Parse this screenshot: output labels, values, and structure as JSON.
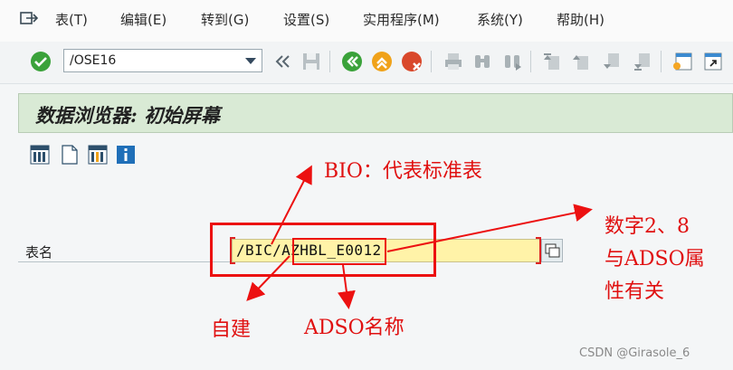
{
  "menu": {
    "items": [
      "表(T)",
      "编辑(E)",
      "转到(G)",
      "设置(S)",
      "实用程序(M)",
      "系统(Y)",
      "帮助(H)"
    ]
  },
  "toolbar": {
    "command_value": "/OSE16"
  },
  "screen": {
    "title": "数据浏览器: 初始屏幕"
  },
  "form": {
    "table_label": "表名",
    "table_value": "/BIC/AZHBL_E0012"
  },
  "annotations": {
    "bio": "BIO：代表标准表",
    "digits_line1": "数字2、8",
    "digits_line2": "与ADSO属",
    "digits_line3": "性有关",
    "self_built": "自建",
    "adso_name": "ADSO名称"
  },
  "watermark": "CSDN @Girasole_6",
  "colors": {
    "annotation": "#ec1111",
    "input_bg": "#fff3a8",
    "title_bg": "#d9ead5"
  }
}
